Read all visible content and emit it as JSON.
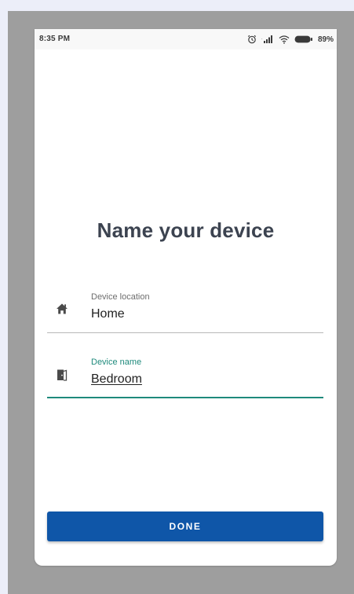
{
  "status_bar": {
    "time": "8:35 PM",
    "battery": "89%",
    "icons": [
      "alarm-icon",
      "signal-icon",
      "wifi-icon",
      "battery-icon"
    ]
  },
  "page": {
    "title": "Name your device"
  },
  "form": {
    "location": {
      "label": "Device location",
      "value": "Home",
      "icon": "home-icon"
    },
    "name": {
      "label": "Device name",
      "value": "Bedroom",
      "icon": "door-icon"
    }
  },
  "actions": {
    "done_label": "DONE"
  },
  "colors": {
    "accent": "#1f8a7c",
    "button": "#0f56a8",
    "title": "#3c4350",
    "frame": "#9e9e9e",
    "background": "#eceef9"
  }
}
